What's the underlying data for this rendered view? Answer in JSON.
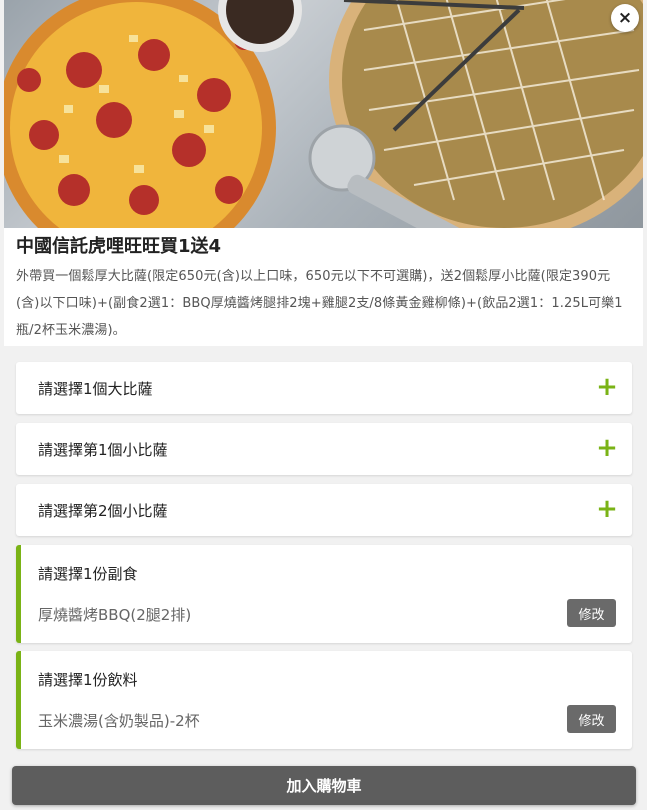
{
  "product": {
    "title": "中國信託虎哩旺旺買1送4",
    "description": "外帶買一個鬆厚大比薩(限定650元(含)以上口味，650元以下不可選購)，送2個鬆厚小比薩(限定390元(含)以下口味)+(副食2選1：BBQ厚燒醬烤腿排2塊+雞腿2支/8條黃金雞柳條)+(飲品2選1：1.25L可樂1瓶/2杯玉米濃湯)。",
    "image_icon": "pizza-photo"
  },
  "close_icon": "×",
  "options": [
    {
      "label": "請選擇1個大比薩",
      "icon": "+"
    },
    {
      "label": "請選擇第1個小比薩",
      "icon": "+"
    },
    {
      "label": "請選擇第2個小比薩",
      "icon": "+"
    }
  ],
  "selections": [
    {
      "label": "請選擇1份副食",
      "value": "厚燒醬烤BBQ(2腿2排)",
      "edit_label": "修改"
    },
    {
      "label": "請選擇1份飲料",
      "value": "玉米濃湯(含奶製品)-2杯",
      "edit_label": "修改"
    }
  ],
  "cart_button": "加入購物車",
  "colors": {
    "accent": "#7ab316",
    "button_gray": "#5d5d5d",
    "edit_gray": "#6a6a6a"
  }
}
